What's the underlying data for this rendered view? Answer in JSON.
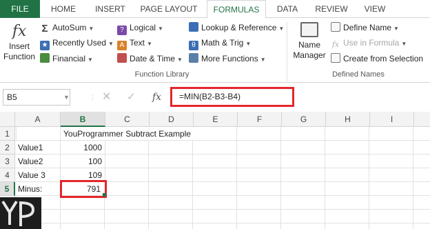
{
  "tabs": [
    "FILE",
    "HOME",
    "INSERT",
    "PAGE LAYOUT",
    "FORMULAS",
    "DATA",
    "REVIEW",
    "VIEW"
  ],
  "ribbon": {
    "insert_function": {
      "line1": "Insert",
      "line2": "Function",
      "glyph": "fx"
    },
    "function_library": {
      "label": "Function Library",
      "col1": [
        "AutoSum",
        "Recently Used",
        "Financial"
      ],
      "col2": [
        "Logical",
        "Text",
        "Date & Time"
      ],
      "col3": [
        "Lookup & Reference",
        "Math & Trig",
        "More Functions"
      ]
    },
    "name_manager": {
      "line1": "Name",
      "line2": "Manager"
    },
    "defined_names": {
      "label": "Defined Names",
      "items": [
        "Define Name",
        "Use in Formula",
        "Create from Selection"
      ]
    }
  },
  "formula_bar": {
    "name_box": "B5",
    "fx_glyph": "fx",
    "formula": "=MIN(B2-B3-B4)"
  },
  "grid": {
    "columns": [
      "A",
      "B",
      "C",
      "D",
      "E",
      "F",
      "G",
      "H",
      "I"
    ],
    "rows": [
      "1",
      "2",
      "3",
      "4",
      "5"
    ],
    "cells": {
      "B1": "YouProgrammer Subtract Example",
      "A2": "Value1",
      "B2": "1000",
      "A3": "Value2",
      "B3": "100",
      "A4": "Value 3",
      "B4": "109",
      "A5": "Minus:",
      "B5": "791"
    }
  },
  "logo": {
    "text": "YP"
  },
  "colors": {
    "accent": "#217346",
    "highlight": "#e3262c"
  }
}
